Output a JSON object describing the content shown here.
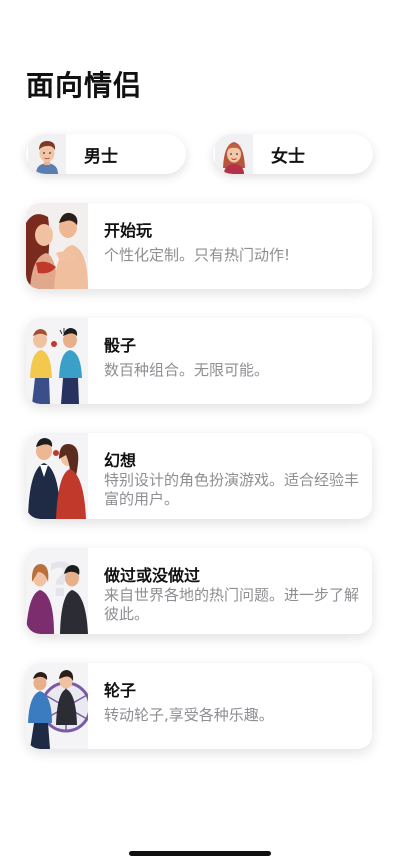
{
  "page": {
    "title": "面向情侣"
  },
  "gender_options": [
    {
      "label": "男士",
      "icon": "man-avatar-icon"
    },
    {
      "label": "女士",
      "icon": "woman-avatar-icon"
    }
  ],
  "games": [
    {
      "title": "开始玩",
      "description": "个性化定制。只有热门动作!",
      "icon": "couple-embrace-illustration"
    },
    {
      "title": "骰子",
      "description": "数百种组合。无限可能。",
      "icon": "couple-dice-illustration"
    },
    {
      "title": "幻想",
      "description": "特别设计的角色扮演游戏。适合经验丰富的用户。",
      "icon": "couple-fantasy-illustration"
    },
    {
      "title": "做过或没做过",
      "description": "来自世界各地的热门问题。进一步了解彼此。",
      "icon": "couple-question-illustration"
    },
    {
      "title": "轮子",
      "description": "转动轮子,享受各种乐趣。",
      "icon": "couple-wheel-illustration"
    }
  ],
  "colors": {
    "background": "#ffffff",
    "title_text": "#111111",
    "description_text": "#8e8e93"
  }
}
